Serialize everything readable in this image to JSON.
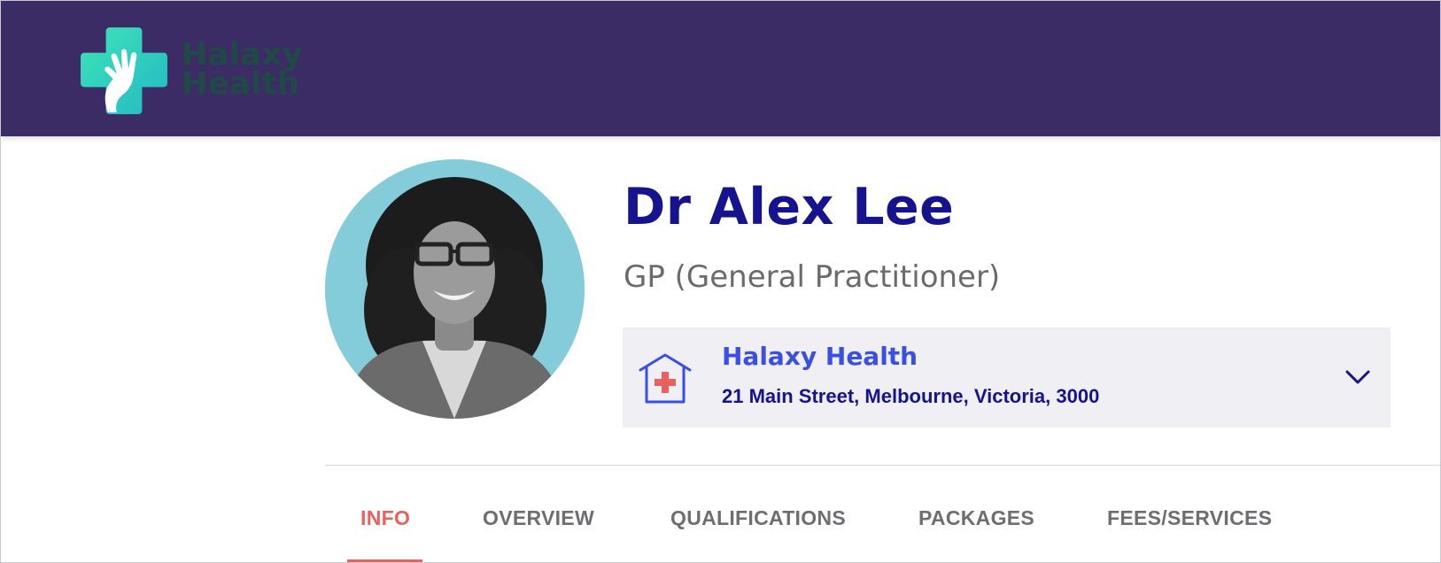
{
  "brand": {
    "logo_line1": "Halaxy",
    "logo_line2": "Health",
    "header_color": "#3c2c65",
    "logo_color": "#2fd6b5"
  },
  "profile": {
    "name": "Dr Alex Lee",
    "specialty": "GP (General Practitioner)",
    "avatar_icon": "profile-photo"
  },
  "location": {
    "name": "Halaxy Health",
    "address": "21 Main Street, Melbourne, Victoria, 3000",
    "icon": "clinic-house-icon",
    "expand_icon": "chevron-down-icon"
  },
  "tabs": [
    {
      "label": "INFO",
      "active": true
    },
    {
      "label": "OVERVIEW",
      "active": false
    },
    {
      "label": "QUALIFICATIONS",
      "active": false
    },
    {
      "label": "PACKAGES",
      "active": false
    },
    {
      "label": "FEES/SERVICES",
      "active": false
    }
  ],
  "colors": {
    "name": "#16138f",
    "location_name": "#3a4fe3",
    "active_tab": "#e8615e",
    "inactive_tab": "#6e6e72"
  }
}
